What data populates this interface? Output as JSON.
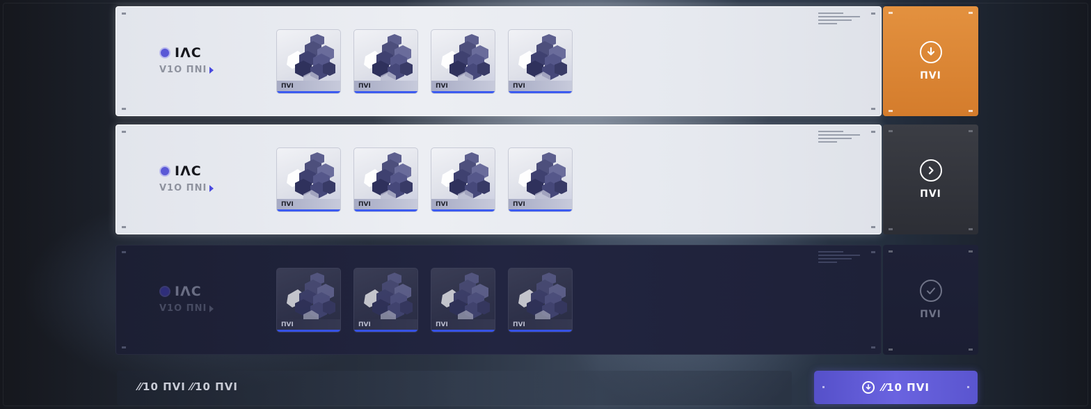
{
  "rows": [
    {
      "state": "light",
      "title": "IΛC",
      "subtitle": "V1O ΠNI",
      "tiles": [
        {
          "tag": "ΠVI"
        },
        {
          "tag": "ΠVI"
        },
        {
          "tag": "ΠVI"
        },
        {
          "tag": "ΠVI"
        }
      ],
      "action": {
        "variant": "orange",
        "icon": "download-icon",
        "label": "ΠVI"
      }
    },
    {
      "state": "light",
      "title": "IΛC",
      "subtitle": "V1O ΠNI",
      "tiles": [
        {
          "tag": "ΠVI"
        },
        {
          "tag": "ΠVI"
        },
        {
          "tag": "ΠVI"
        },
        {
          "tag": "ΠVI"
        }
      ],
      "action": {
        "variant": "grey",
        "icon": "chevron-right-icon",
        "label": "ΠVI"
      }
    },
    {
      "state": "dark",
      "title": "IΛC",
      "subtitle": "V1O ΠNI",
      "tiles": [
        {
          "tag": "ΠVI"
        },
        {
          "tag": "ΠVI"
        },
        {
          "tag": "ΠVI"
        },
        {
          "tag": "ΠVI"
        }
      ],
      "action": {
        "variant": "done",
        "icon": "check-icon",
        "label": "ΠVI"
      }
    }
  ],
  "footer": {
    "text": "⁄⁄10 ΠVI ⁄⁄10 ΠVI",
    "button_label": "⁄⁄10 ΠVI",
    "button_icon": "download-icon"
  },
  "colors": {
    "accent_orange": "#d9832f",
    "accent_purple": "#5f59d6",
    "tile_underline": "#3c5bf0"
  }
}
